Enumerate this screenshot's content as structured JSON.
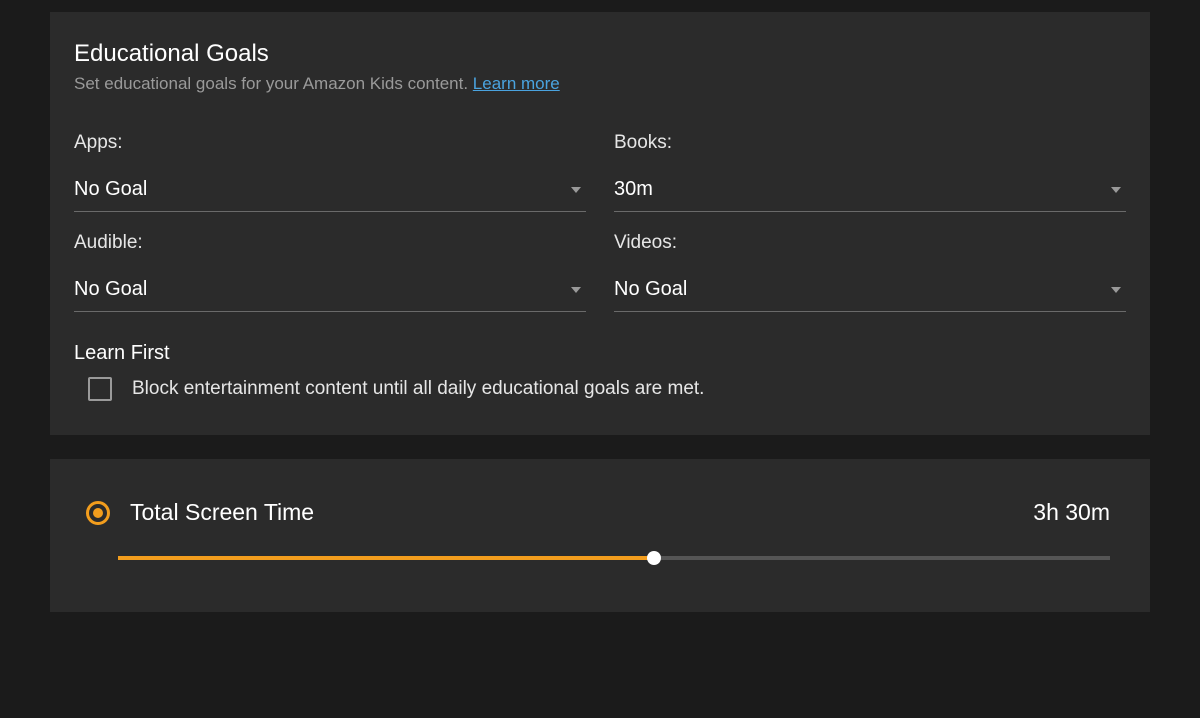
{
  "educational_goals": {
    "title": "Educational Goals",
    "subtitle_pre": "Set educational goals for your Amazon Kids content. ",
    "learn_more": "Learn more",
    "fields": {
      "apps": {
        "label": "Apps:",
        "value": "No Goal"
      },
      "books": {
        "label": "Books:",
        "value": "30m"
      },
      "audible": {
        "label": "Audible:",
        "value": "No Goal"
      },
      "videos": {
        "label": "Videos:",
        "value": "No Goal"
      }
    },
    "learn_first": {
      "title": "Learn First",
      "checkbox_label": "Block entertainment content until all daily educational goals are met.",
      "checked": false
    }
  },
  "screen_time": {
    "title": "Total Screen Time",
    "value": "3h 30m",
    "slider_percent": 54
  },
  "colors": {
    "accent": "#f29d1d",
    "link": "#4aa3df"
  }
}
